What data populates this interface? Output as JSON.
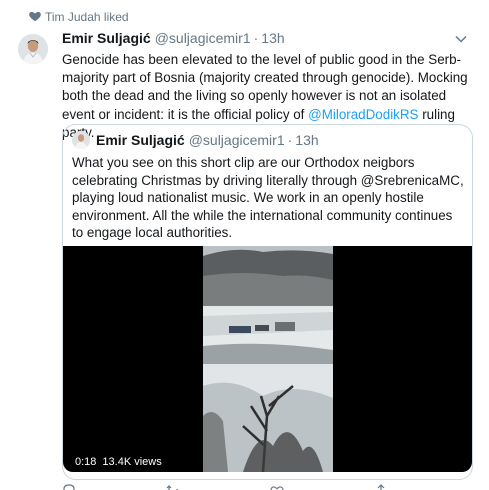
{
  "social_context": {
    "text": "Tim Judah liked",
    "icon": "heart-icon"
  },
  "tweet": {
    "author_name": "Emir Suljagić",
    "author_handle": "@suljagicemir1",
    "separator": "·",
    "time": "13h",
    "text_before": "Genocide has been elevated to the level of public good in the Serb-majority part of Bosnia (majority created through genocide). Mocking both the dead and the living so openly however is not an isolated event or incident: it is the official policy of ",
    "mention": "@MiloradDodikRS",
    "text_after": " ruling party."
  },
  "quote": {
    "author_name": "Emir Suljagić",
    "author_handle": "@suljagicemir1",
    "separator": "·",
    "time": "13h",
    "text": "What you see on this short clip are our Orthodox neigbors celebrating Christmas by driving literally through @SrebrenicaMC, playing loud nationalist music. We work in an openly hostile environment. All the while the international community continues to engage local authorities.",
    "video": {
      "duration": "0:18",
      "views": "13.4K views"
    }
  },
  "colors": {
    "accent": "#1da1f2",
    "secondary_text": "#657786",
    "border": "#ccd6dd"
  }
}
